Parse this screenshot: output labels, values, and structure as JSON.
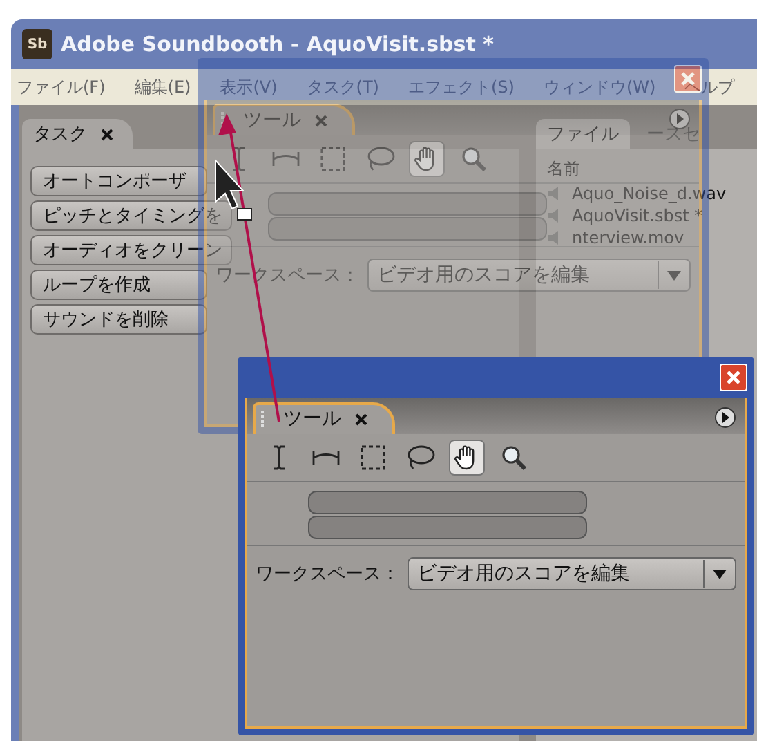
{
  "window": {
    "title": "Adobe Soundbooth - AquoVisit.sbst *",
    "app_icon": "Sb"
  },
  "menu": [
    "ファイル(F)",
    "編集(E)",
    "表示(V)",
    "タスク(T)",
    "エフェクト(S)",
    "ウィンドウ(W)",
    "ヘルプ"
  ],
  "tasks_panel": {
    "tab": "タスク",
    "buttons": [
      "オートコンポーザ",
      "ピッチとタイミングを",
      "オーディオをクリーン",
      "ループを作成",
      "サウンドを削除"
    ]
  },
  "files_panel": {
    "tabs": [
      {
        "label": "ファイル",
        "selected": true
      },
      {
        "label": "ースセ",
        "selected": false
      }
    ],
    "column": "名前",
    "files": [
      "Aquo_Noise_d.wav",
      "AquoVisit.sbst *",
      "nterview.mov"
    ]
  },
  "drag_preview": {
    "tab": "ツール",
    "tools": [
      {
        "kind": "ibeam",
        "selected": false
      },
      {
        "kind": "range",
        "selected": false
      },
      {
        "kind": "marquee",
        "selected": false
      },
      {
        "kind": "lasso",
        "selected": false
      },
      {
        "kind": "hand",
        "selected": true
      },
      {
        "kind": "zoom",
        "selected": false
      }
    ],
    "workspace_label": "ワークスペース：",
    "workspace_value": "ビデオ用のスコアを編集"
  },
  "floating_panel": {
    "tab": "ツール",
    "tools": [
      {
        "kind": "ibeam",
        "selected": false
      },
      {
        "kind": "range",
        "selected": false
      },
      {
        "kind": "marquee",
        "selected": false
      },
      {
        "kind": "lasso",
        "selected": false
      },
      {
        "kind": "hand",
        "selected": true
      },
      {
        "kind": "zoom",
        "selected": false
      }
    ],
    "workspace_label": "ワークスペース：",
    "workspace_value": "ビデオ用のスコアを編集"
  }
}
